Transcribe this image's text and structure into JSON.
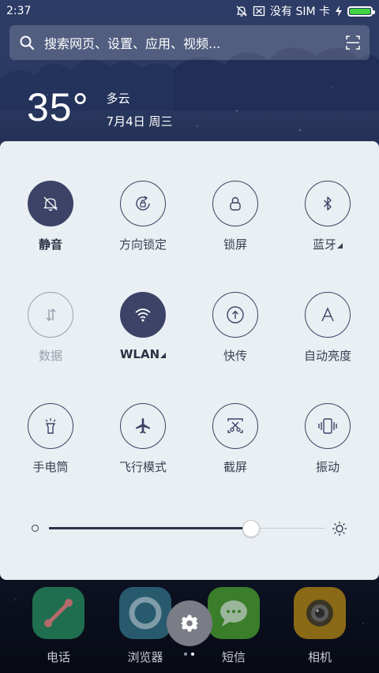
{
  "status_bar": {
    "time": "2:37",
    "carrier": "没有 SIM 卡",
    "icons": [
      "mute-bell-icon",
      "no-sim-icon",
      "charging-icon",
      "battery-icon"
    ],
    "battery_color": "#3fd53f"
  },
  "search": {
    "placeholder": "搜索网页、设置、应用、视频...",
    "icons": [
      "search-icon",
      "scan-icon"
    ]
  },
  "weather": {
    "temperature": "35°",
    "condition": "多云",
    "date": "7月4日 周三"
  },
  "quick_settings": {
    "tiles": [
      {
        "label": "静音",
        "icon": "mute-bell-icon",
        "state": "active"
      },
      {
        "label": "方向锁定",
        "icon": "rotation-lock-icon",
        "state": "off"
      },
      {
        "label": "锁屏",
        "icon": "lock-icon",
        "state": "off"
      },
      {
        "label": "蓝牙",
        "icon": "bluetooth-icon",
        "state": "off",
        "expandable": true
      },
      {
        "label": "数据",
        "icon": "mobile-data-icon",
        "state": "disabled"
      },
      {
        "label": "WLAN",
        "icon": "wifi-icon",
        "state": "active",
        "expandable": true
      },
      {
        "label": "快传",
        "icon": "quick-transfer-icon",
        "state": "off"
      },
      {
        "label": "自动亮度",
        "icon": "auto-brightness-icon",
        "state": "off"
      },
      {
        "label": "手电筒",
        "icon": "flashlight-icon",
        "state": "off"
      },
      {
        "label": "飞行模式",
        "icon": "airplane-icon",
        "state": "off"
      },
      {
        "label": "截屏",
        "icon": "screenshot-icon",
        "state": "off"
      },
      {
        "label": "振动",
        "icon": "vibrate-icon",
        "state": "off"
      }
    ],
    "active_color": "#3c4366",
    "brightness": {
      "level": 0.73
    }
  },
  "dock": {
    "apps": [
      {
        "label": "电话",
        "icon": "phone-app-icon",
        "color": "#3fa872"
      },
      {
        "label": "浏览器",
        "icon": "browser-app-icon",
        "color": "#4aa3c8"
      },
      {
        "label": "短信",
        "icon": "messages-app-icon",
        "color": "#5ec13a"
      },
      {
        "label": "相机",
        "icon": "camera-app-icon",
        "color": "#f2b51d"
      }
    ],
    "settings_icon": "gear-icon",
    "pages": 2,
    "current_page": 2
  }
}
